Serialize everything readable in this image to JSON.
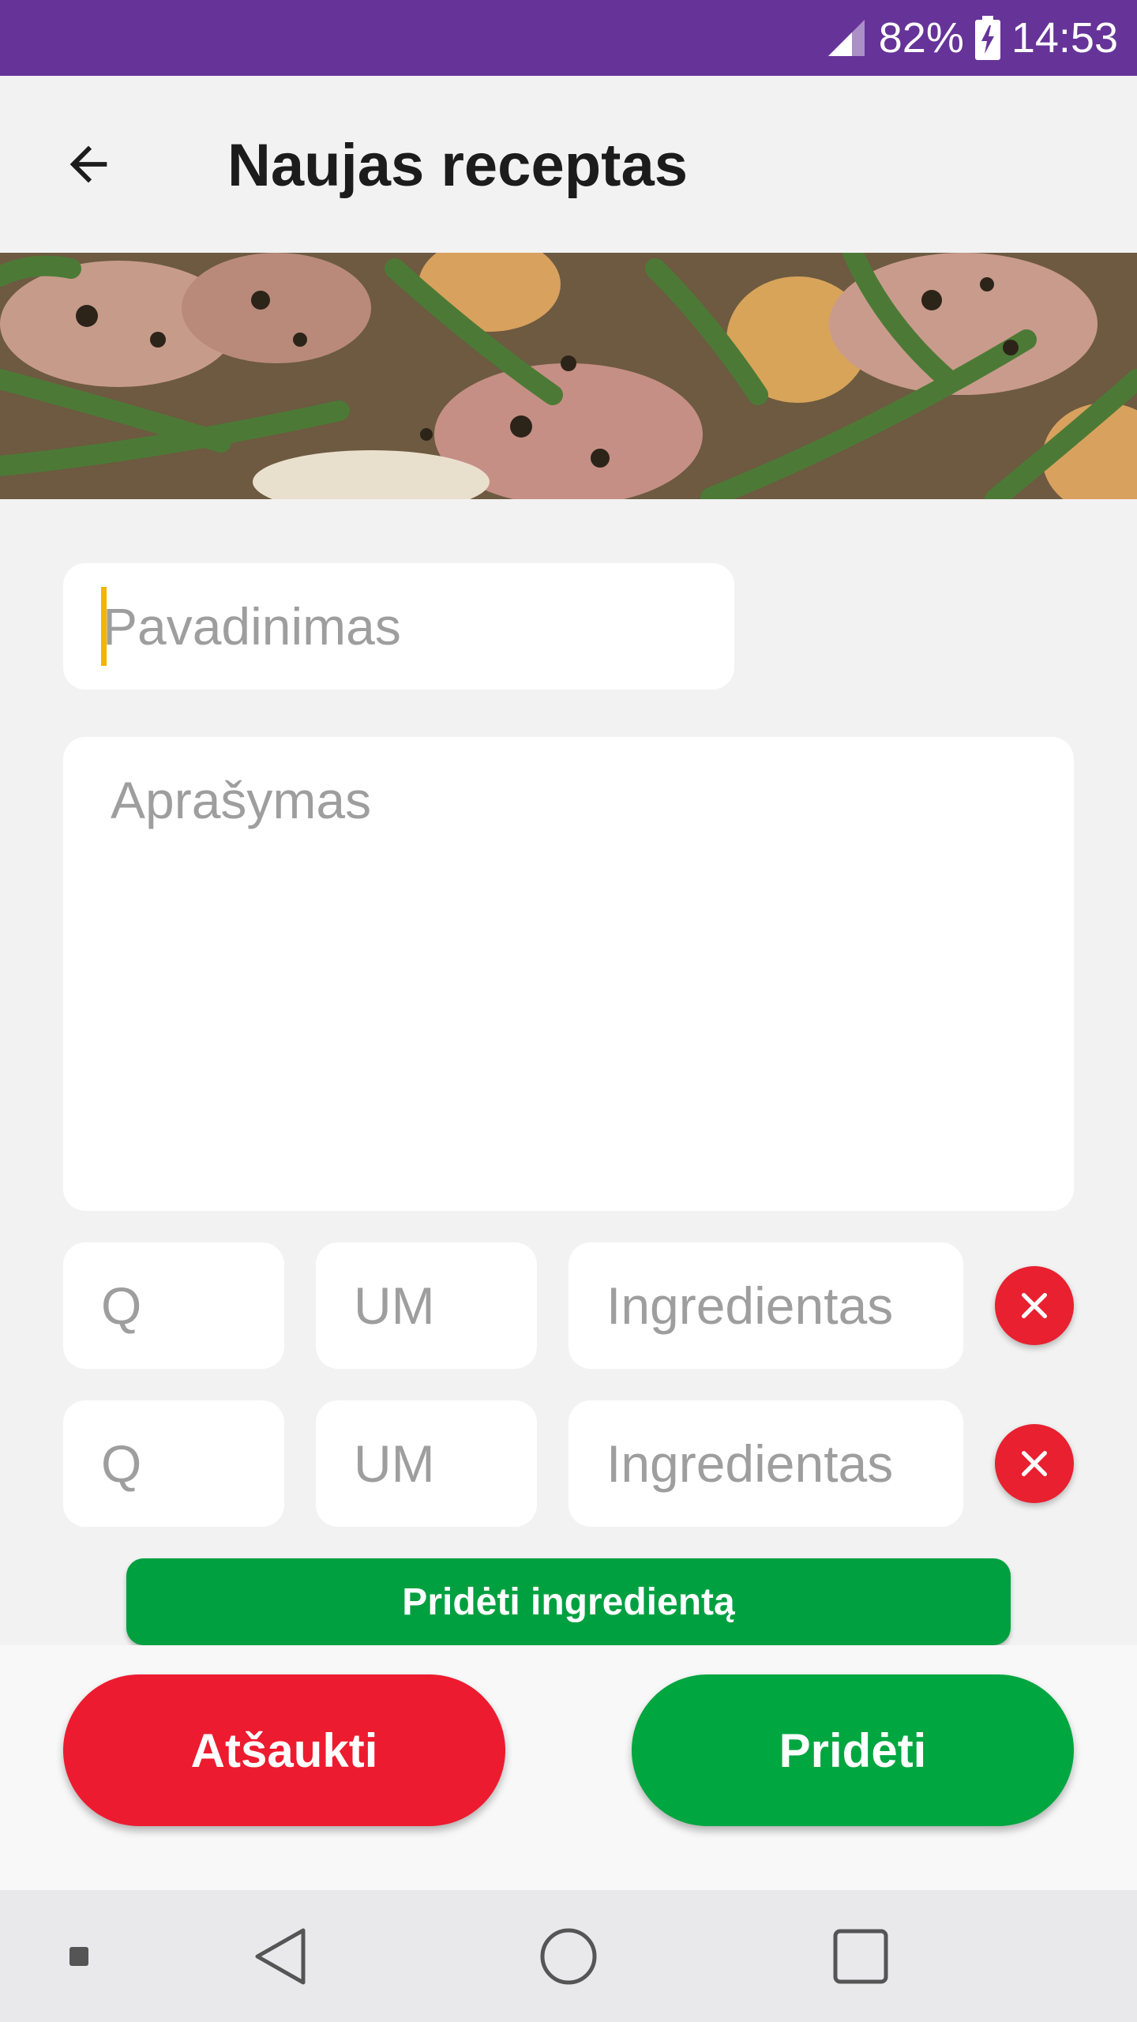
{
  "status_bar": {
    "battery_percent": "82%",
    "time": "14:53",
    "signal_icon": "signal-icon",
    "battery_icon": "battery-charging-icon"
  },
  "app_bar": {
    "title": "Naujas receptas",
    "back_icon": "arrow-back-icon"
  },
  "hero": {
    "image": "recipe-photo-chicken-green-beans"
  },
  "form": {
    "name_placeholder": "Pavadinimas",
    "description_placeholder": "Aprašymas",
    "ingredient_rows": [
      {
        "quantity_placeholder": "Q",
        "unit_placeholder": "UM",
        "ingredient_placeholder": "Ingredientas"
      },
      {
        "quantity_placeholder": "Q",
        "unit_placeholder": "UM",
        "ingredient_placeholder": "Ingredientas"
      }
    ],
    "add_ingredient_label": "Pridėti ingredientą"
  },
  "actions": {
    "cancel_label": "Atšaukti",
    "submit_label": "Pridėti"
  },
  "colors": {
    "status_bar": "#663399",
    "cancel": "#ed1b2f",
    "submit": "#00a640",
    "remove": "#e8202f",
    "caret": "#f4b400"
  },
  "nav_bar": {
    "icons": [
      "nav-dot-icon",
      "nav-back-icon",
      "nav-home-icon",
      "nav-recent-icon"
    ]
  }
}
